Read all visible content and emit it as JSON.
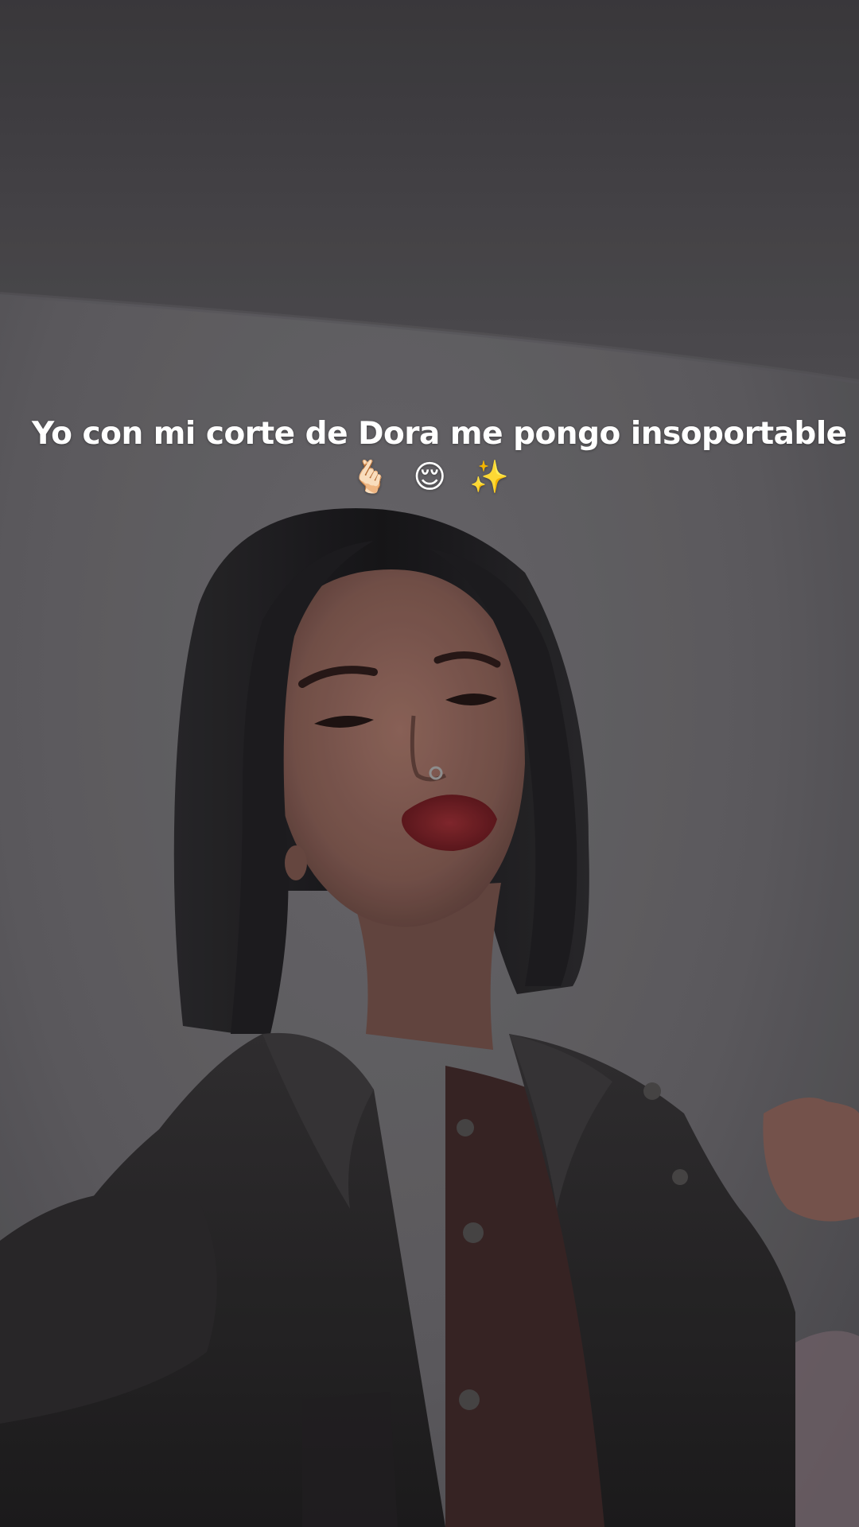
{
  "caption": {
    "text": "Yo con mi corte de Dora me pongo insoportable",
    "emojis": [
      "🫰🏻",
      "😌",
      "✨"
    ]
  },
  "colors": {
    "ceiling": "#4a484c",
    "wall": "#6b696d",
    "hair": "#1c1b1e",
    "skin": "#8a6259",
    "lips": "#6e1c22",
    "jacket": "#2a2829",
    "top": "#3a2424"
  }
}
